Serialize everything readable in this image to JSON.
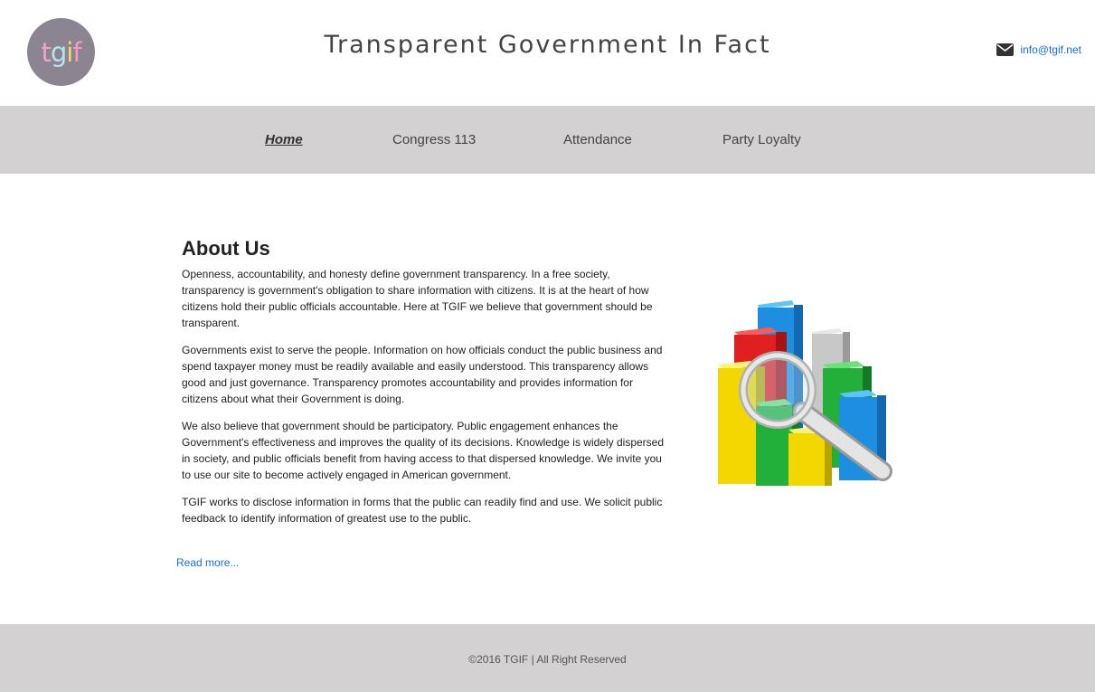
{
  "header": {
    "logo_letters": [
      "t",
      "g",
      "i",
      "f"
    ],
    "logo_colors": [
      "#f5a0c8",
      "#b9e2f0",
      "#f4d86a",
      "#f39ac2"
    ],
    "site_title": "Transparent Government In Fact",
    "email_icon": "envelope-icon",
    "email": "info@tgif.net"
  },
  "nav": {
    "items": [
      {
        "label": "Home",
        "active": true
      },
      {
        "label": "Congress 113",
        "active": false
      },
      {
        "label": "Attendance",
        "active": false
      },
      {
        "label": "Party Loyalty",
        "active": false
      }
    ]
  },
  "main": {
    "title": "About Us",
    "paragraphs": [
      "Openness, accountability, and honesty define government transparency. In a free society, transparency is government's obligation to share information with citizens. It is at the heart of how citizens hold their public officials accountable. Here at TGIF we believe that government should be transparent.",
      "Governments exist to serve the people. Information on how officials conduct the public business and spend taxpayer money must be readily available and easily understood. This transparency allows good and just governance. Transparency promotes accountability and provides information for citizens about what their Government is doing.",
      "We also believe that government should be participatory. Public engagement enhances the Government's effectiveness and improves the quality of its decisions. Knowledge is widely dispersed in society, and public officials benefit from having access to that dispersed knowledge. We invite you to use our site to become actively engaged in American government.",
      "TGIF works to disclose information in forms that the public can readily find and use. We solicit public feedback to identify information of greatest use to the public."
    ],
    "read_more": "Read more...",
    "image_icon": "bar-chart-magnifier-illustration"
  },
  "footer": {
    "copyright": "©2016 TGIF | All Right Reserved"
  }
}
